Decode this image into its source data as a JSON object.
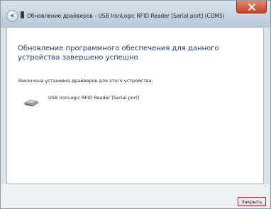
{
  "window": {
    "title": "Обновление драйверов - USB IronLogic RFID Reader [Serial port] (COM5)"
  },
  "main": {
    "heading": "Обновление программного обеспечения для данного устройства завершено успешно",
    "subtext": "Закончена установка драйверов для этого устройства:",
    "device_name": "USB IronLogic RFID Reader [Serial port]",
    "device_icon": "usb-device-icon"
  },
  "footer": {
    "close_label": "Закрыть"
  },
  "colors": {
    "heading": "#1e3a7a",
    "close_button_border": "#d21f1f",
    "titlebar_close": "#c44326"
  }
}
